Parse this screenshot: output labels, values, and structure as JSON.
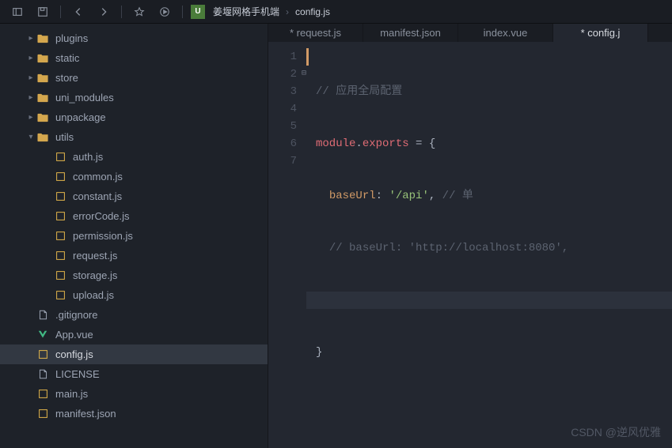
{
  "breadcrumb": {
    "project": "姜堰网格手机端",
    "file": "config.js"
  },
  "tabs": [
    {
      "label": "* request.js"
    },
    {
      "label": "manifest.json"
    },
    {
      "label": "index.vue"
    },
    {
      "label": "* config.j"
    }
  ],
  "tree": {
    "folders": [
      {
        "name": "plugins",
        "expanded": false,
        "depth": 1
      },
      {
        "name": "static",
        "expanded": false,
        "depth": 1
      },
      {
        "name": "store",
        "expanded": false,
        "depth": 1
      },
      {
        "name": "uni_modules",
        "expanded": false,
        "depth": 1
      },
      {
        "name": "unpackage",
        "expanded": false,
        "depth": 1
      },
      {
        "name": "utils",
        "expanded": true,
        "depth": 1
      }
    ],
    "utils_files": [
      "auth.js",
      "common.js",
      "constant.js",
      "errorCode.js",
      "permission.js",
      "request.js",
      "storage.js",
      "upload.js"
    ],
    "root_files": [
      {
        "name": ".gitignore",
        "icon": "file"
      },
      {
        "name": "App.vue",
        "icon": "vue"
      },
      {
        "name": "config.js",
        "icon": "js",
        "selected": true
      },
      {
        "name": "LICENSE",
        "icon": "file"
      },
      {
        "name": "main.js",
        "icon": "js"
      },
      {
        "name": "manifest.json",
        "icon": "json"
      }
    ]
  },
  "code": {
    "l1": "// 应用全局配置",
    "l2a": "module",
    "l2b": ".",
    "l2c": "exports",
    "l2d": " = {",
    "l3a": "baseUrl",
    "l3b": ": ",
    "l3c": "'/api'",
    "l3d": ", ",
    "l3e": "// 单",
    "l4": "// baseUrl: 'http://localhost:8080',",
    "l6": "}"
  },
  "lines": [
    "1",
    "2",
    "3",
    "4",
    "5",
    "6",
    "7"
  ],
  "watermark": "CSDN @逆风优雅"
}
